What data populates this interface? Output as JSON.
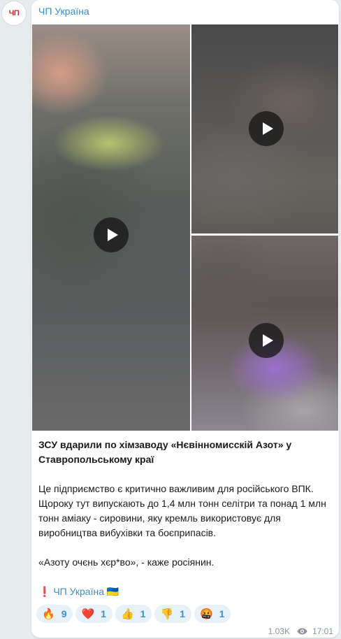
{
  "channel": {
    "name": "ЧП Україна",
    "avatar_text": "ЧП",
    "accent_color": "#3a8fd0",
    "avatar_color": "#e0262e"
  },
  "media": {
    "tiles": [
      {
        "kind": "video",
        "icon": "play-icon"
      },
      {
        "kind": "video",
        "icon": "play-icon"
      },
      {
        "kind": "video",
        "icon": "play-icon"
      }
    ]
  },
  "post": {
    "title": "ЗСУ вдарили по хімзаводу «Нєвінномисскій Азот» у Ставропольському краї",
    "paragraph1": "Це підприємство є критично важливим для російського ВПК. Щороку тут випускають до 1,4 млн тонн селітри та понад 1 млн тонн аміаку - сировини, яку кремль використовує для виробництва вибухівки та боєприпасів.",
    "paragraph2": "«Азоту очєнь хєр*во», - каже росіянин.",
    "signature_prefix": "❗",
    "signature_link": "ЧП Україна",
    "signature_suffix": "🇺🇦"
  },
  "reactions": [
    {
      "emoji": "🔥",
      "icon": "fire-icon",
      "count": "9"
    },
    {
      "emoji": "❤️",
      "icon": "heart-icon",
      "count": "1"
    },
    {
      "emoji": "👍",
      "icon": "thumbs-up-icon",
      "count": "1"
    },
    {
      "emoji": "👎",
      "icon": "thumbs-down-icon",
      "count": "1"
    },
    {
      "emoji": "🤬",
      "icon": "angry-face-icon",
      "count": "1"
    }
  ],
  "footer": {
    "views": "1.03K",
    "time": "17:01"
  }
}
